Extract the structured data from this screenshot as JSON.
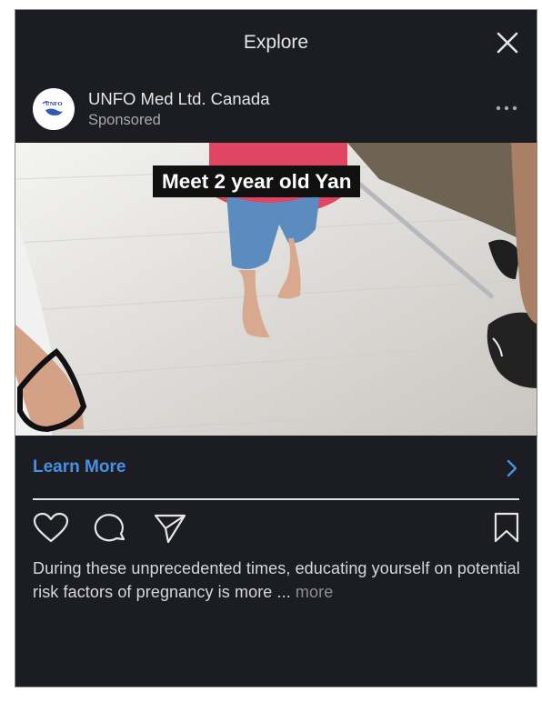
{
  "header": {
    "title": "Explore",
    "close_icon": "close-icon"
  },
  "account": {
    "name": "UNFO Med Ltd. Canada",
    "sponsored_label": "Sponsored",
    "avatar_logo_text": "UNFO",
    "more_icon": "more-horizontal-icon"
  },
  "media": {
    "overlay_caption": "Meet 2 year old Yan"
  },
  "cta": {
    "label": "Learn More",
    "icon": "chevron-right-icon",
    "color": "#4a90e2"
  },
  "actions": {
    "like_icon": "heart-icon",
    "comment_icon": "comment-icon",
    "share_icon": "send-icon",
    "save_icon": "bookmark-icon"
  },
  "caption": {
    "text": "During these unprecedented times, educating yourself on potential risk factors of pregnancy is more ...",
    "more_label": "more"
  },
  "colors": {
    "background": "#1c1d22",
    "text": "#e6e6e6",
    "muted": "#a9a9ad"
  }
}
